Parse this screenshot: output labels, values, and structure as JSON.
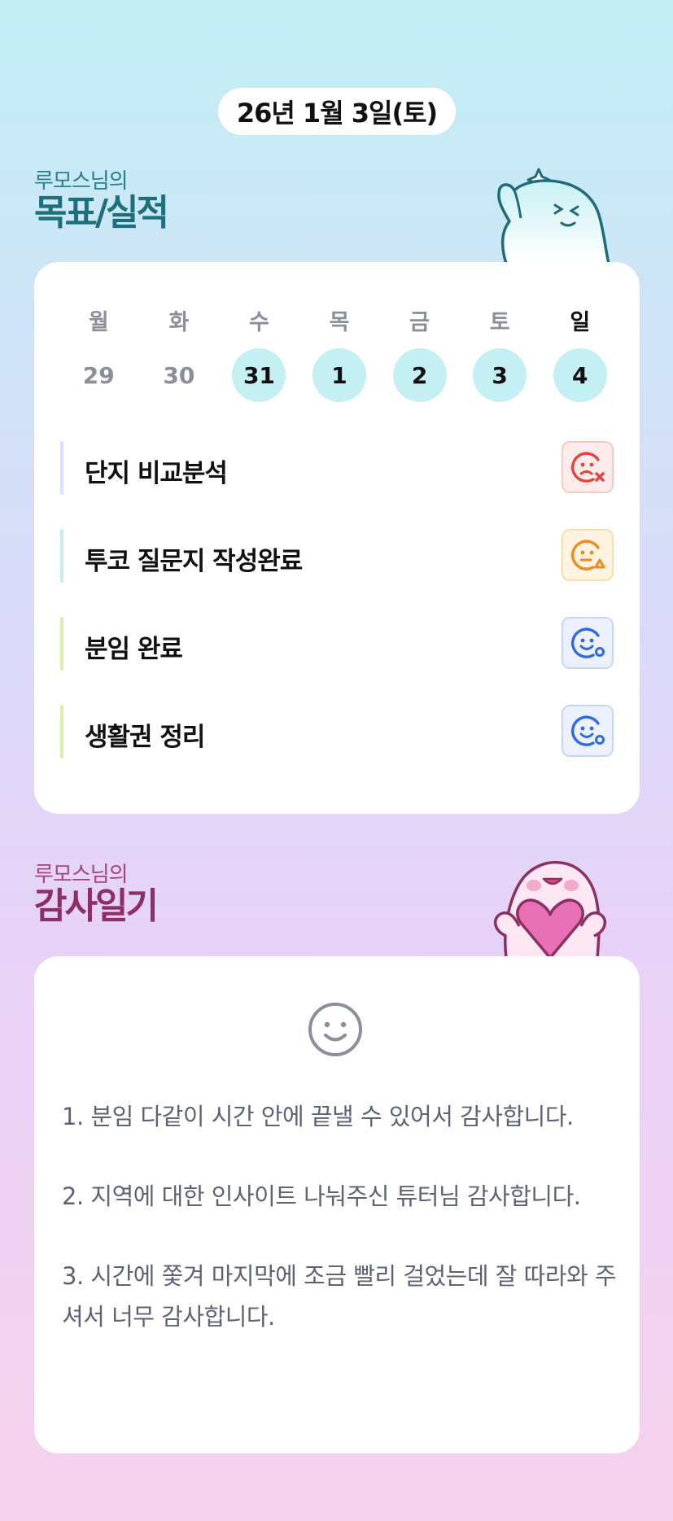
{
  "date_label": "26년 1월 3일(토)",
  "goals_section": {
    "subtitle": "루모스님의",
    "title": "목표/실적"
  },
  "week": {
    "days": [
      "월",
      "화",
      "수",
      "목",
      "금",
      "토",
      "일"
    ],
    "dates": [
      "29",
      "30",
      "31",
      "1",
      "2",
      "3",
      "4"
    ]
  },
  "goals": [
    {
      "label": "단지 비교분석",
      "bar_color": "#d9e3fb",
      "status": "fail",
      "status_icon": "sad-x-face-icon",
      "icon_color": "#e2453c",
      "icon_bg": "#fdeceb",
      "icon_border": "#f7c9c6"
    },
    {
      "label": "투코 질문지 작성완료",
      "bar_color": "#c7eef3",
      "status": "partial",
      "status_icon": "neutral-triangle-face-icon",
      "icon_color": "#f08a1c",
      "icon_bg": "#fff4e2",
      "icon_border": "#fbdcae"
    },
    {
      "label": "분임 완료",
      "bar_color": "#dcedb0",
      "status": "done",
      "status_icon": "happy-circle-face-icon",
      "icon_color": "#2f6ae0",
      "icon_bg": "#edf1fd",
      "icon_border": "#c9d5f6"
    },
    {
      "label": "생활권 정리",
      "bar_color": "#dcedb0",
      "status": "done",
      "status_icon": "happy-circle-face-icon",
      "icon_color": "#2f6ae0",
      "icon_bg": "#edf1fd",
      "icon_border": "#c9d5f6"
    }
  ],
  "thanks_section": {
    "subtitle": "루모스님의",
    "title": "감사일기",
    "mood_icon": "smile-face-icon",
    "entries": [
      "1. 분임 다같이 시간 안에 끝낼 수 있어서 감사합니다.",
      "2. 지역에 대한 인사이트 나눠주신 튜터님 감사합니다.",
      "3. 시간에 쫓겨 마지막에 조금 빨리 걸었는데 잘 따라와 주셔서 너무 감사합니다."
    ]
  },
  "colors": {
    "accent_teal": "#1d6f7b",
    "accent_pink": "#8e2f64",
    "active_date": "#c4eff3"
  }
}
